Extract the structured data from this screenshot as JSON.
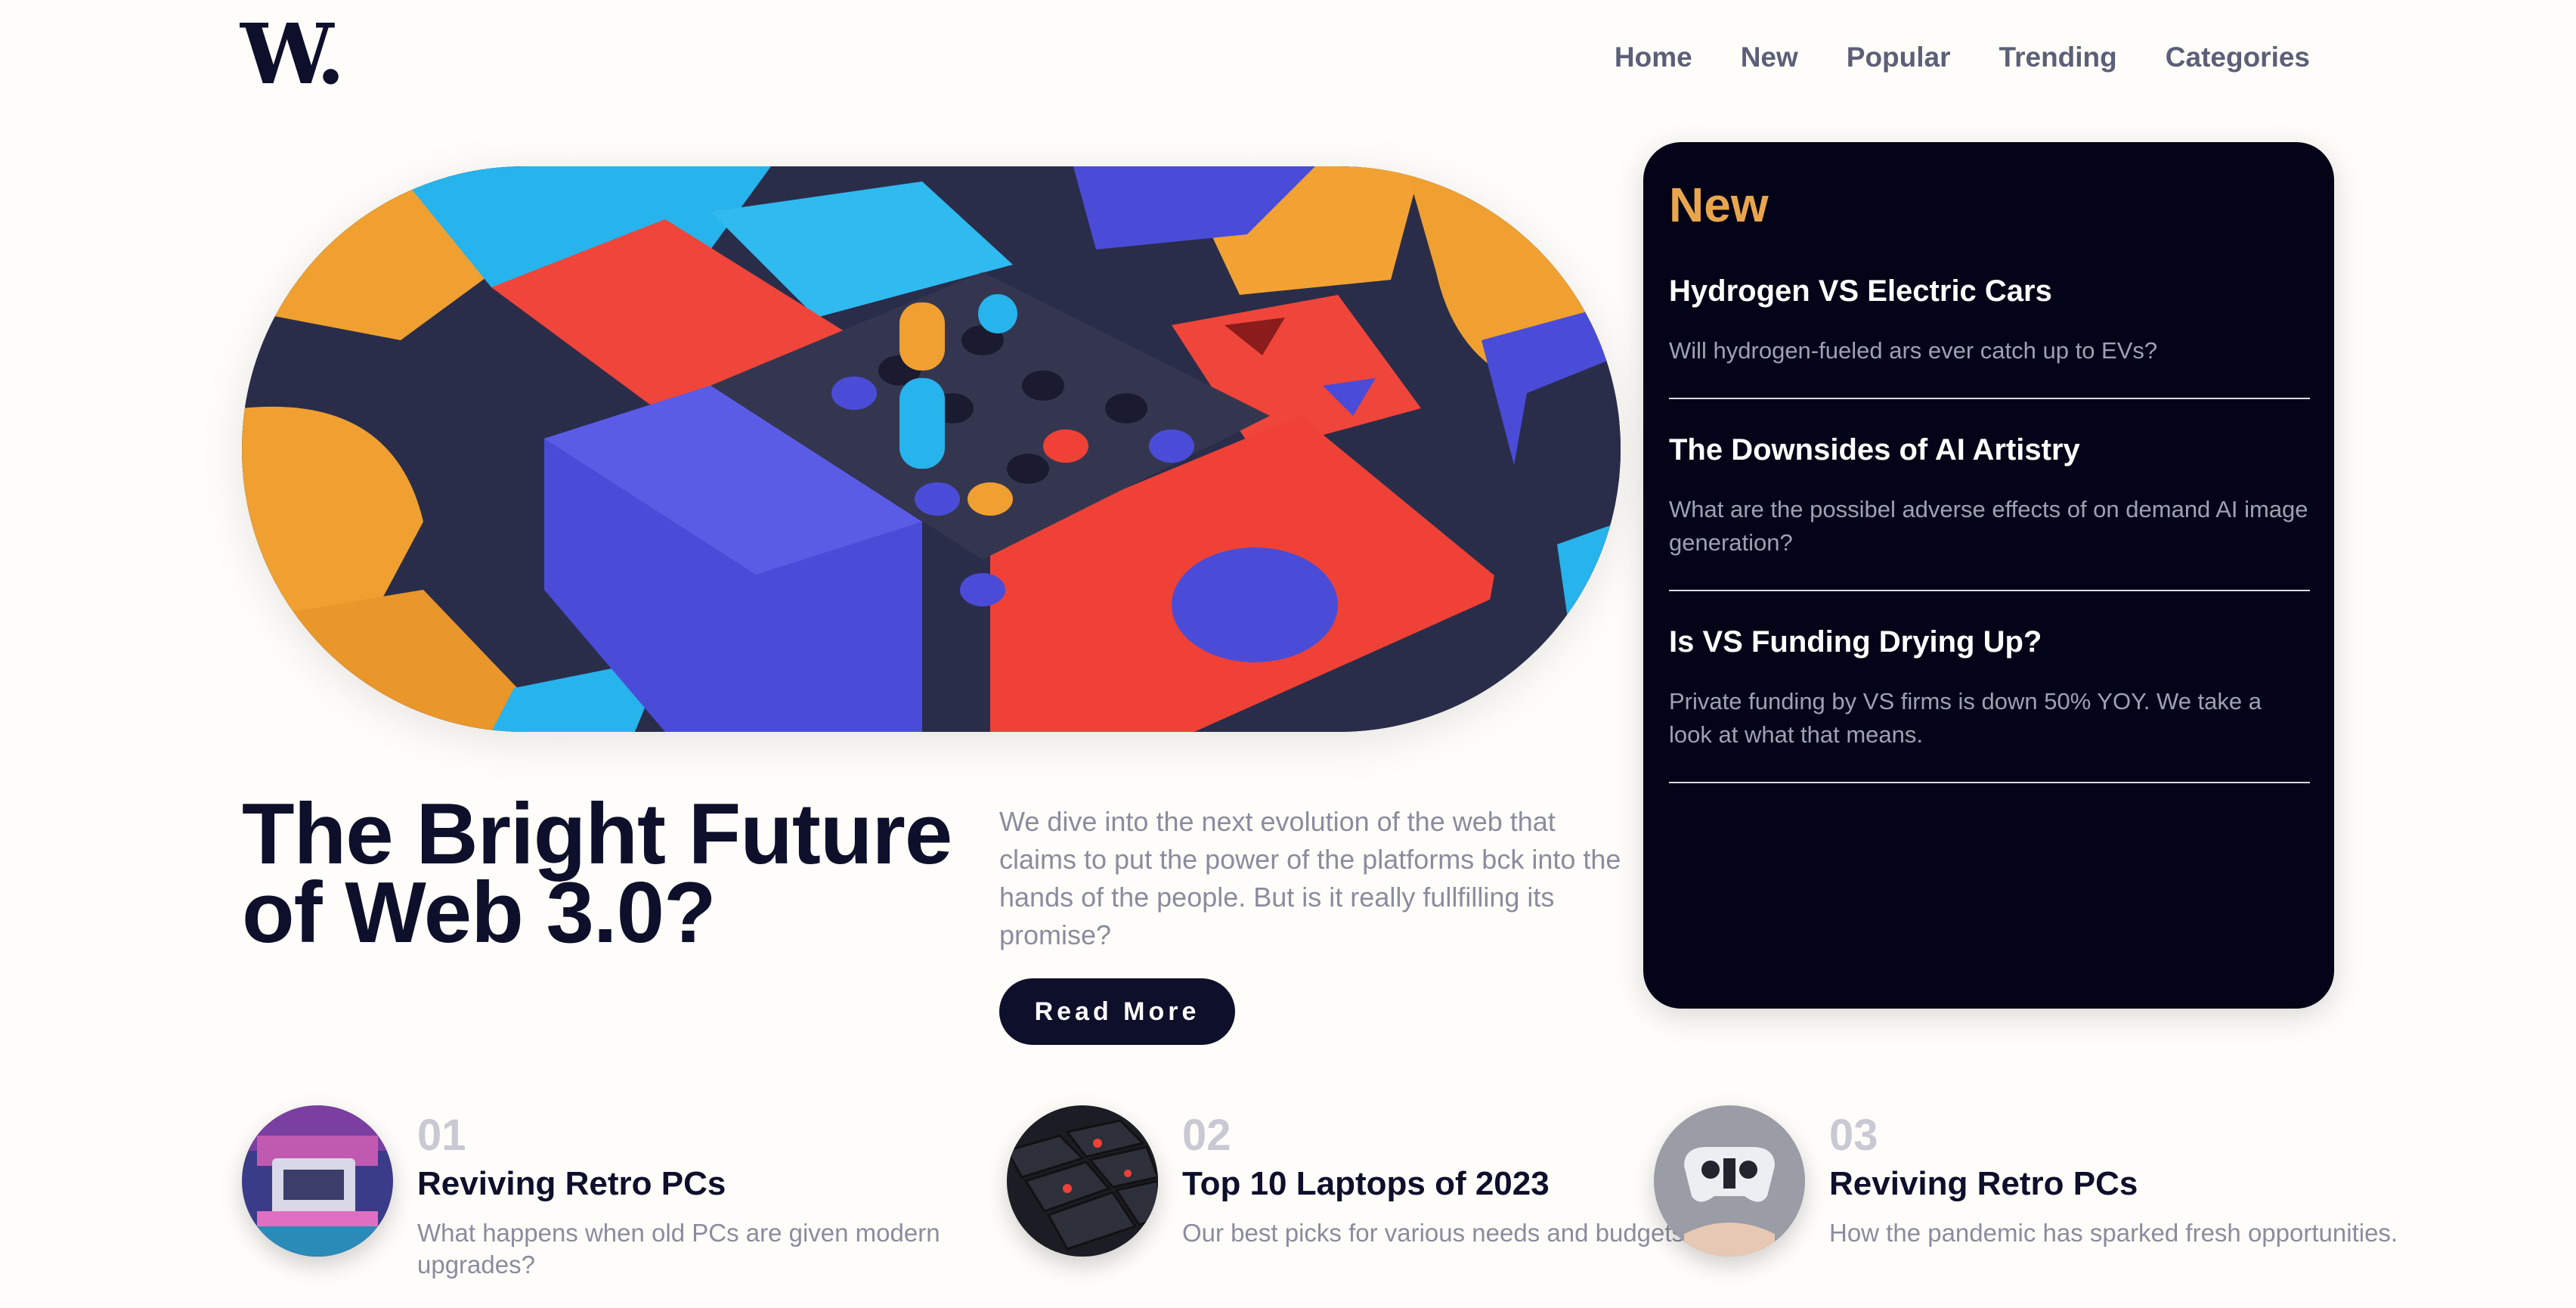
{
  "logo": {
    "text": "W",
    "dot": "."
  },
  "nav": {
    "items": [
      {
        "label": "Home"
      },
      {
        "label": "New"
      },
      {
        "label": "Popular"
      },
      {
        "label": "Trending"
      },
      {
        "label": "Categories"
      }
    ]
  },
  "hero": {
    "title": "The Bright Future of Web 3.0?",
    "description": "We dive into the next evolution of the web that claims to put the power of the platforms bck into the hands of the people. But is it really fullfilling its promise?",
    "button_label": "Read More"
  },
  "new_panel": {
    "heading": "New",
    "items": [
      {
        "title": "Hydrogen VS Electric Cars",
        "description": "Will hydrogen-fueled ars ever catch up to EVs?"
      },
      {
        "title": "The Downsides of AI Artistry",
        "description": "What are the possibel adverse effects of on demand AI image generation?"
      },
      {
        "title": "Is VS Funding Drying Up?",
        "description": "Private funding by VS firms is down 50% YOY. We take a look at what that means."
      }
    ]
  },
  "bottom": {
    "items": [
      {
        "number": "01",
        "title": "Reviving Retro PCs",
        "description": "What happens when old PCs are given modern upgrades?"
      },
      {
        "number": "02",
        "title": "Top 10 Laptops of 2023",
        "description": "Our best picks for various needs and budgets."
      },
      {
        "number": "03",
        "title": "Reviving Retro PCs",
        "description": "How the pandemic has sparked fresh opportunities."
      }
    ]
  },
  "colors": {
    "dark": "#0d0f2b",
    "panel": "#030417",
    "accent": "#e9a54e",
    "muted": "#8a8c9e",
    "nav": "#5c5f77"
  }
}
